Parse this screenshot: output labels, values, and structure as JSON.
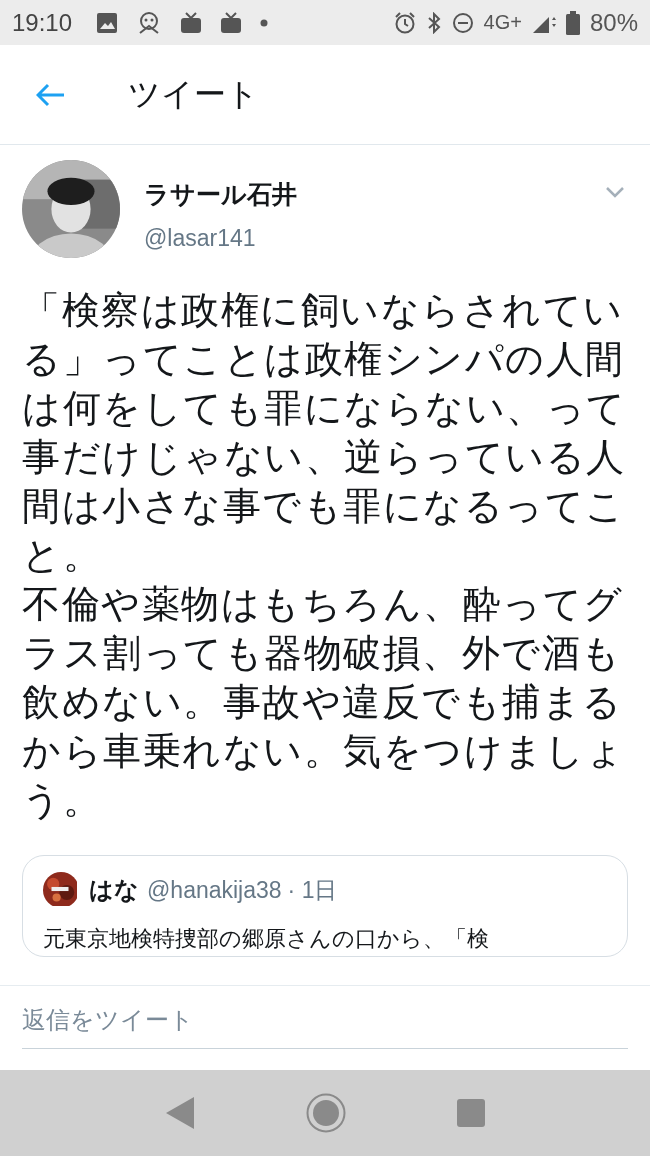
{
  "status_bar": {
    "time": "19:10",
    "network": "4G+",
    "battery": "80%"
  },
  "header": {
    "title": "ツイート"
  },
  "tweet": {
    "author": {
      "name": "ラサール石井",
      "handle": "@lasar141"
    },
    "paragraphs": [
      "「検察は政権に飼いならされている」ってことは政権シンパの人間は何をしても罪にならない、って事だけじゃない、逆らっている人間は小さな事でも罪になるってこと。",
      "不倫や薬物はもちろん、酔ってグラス割っても器物破損、外で酒も飲めない。事故や違反でも捕まるから車乗れない。気をつけましょう。"
    ],
    "quoted": {
      "name": "はな",
      "handle": "@hanakija38",
      "time": "· 1日",
      "text": "元東京地検特捜部の郷原さんの口から、「検"
    }
  },
  "reply": {
    "placeholder": "返信をツイート"
  }
}
